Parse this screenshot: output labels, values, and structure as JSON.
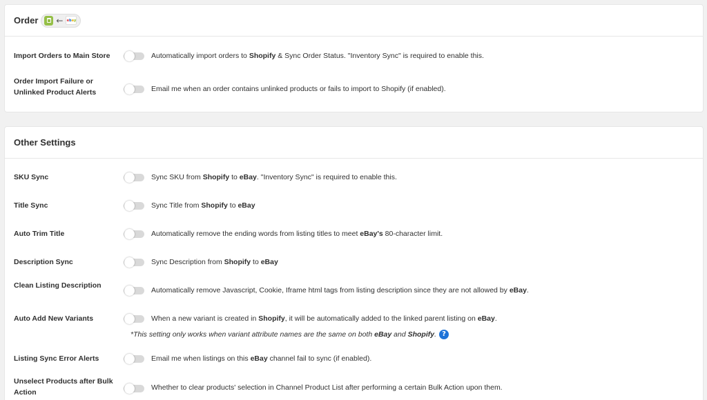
{
  "order_card": {
    "title": "Order",
    "rows": [
      {
        "label": "Import Orders to Main Store",
        "desc": [
          "Automatically import orders to ",
          "Shopify",
          " & Sync Order Status. \"Inventory Sync\" is required to enable this."
        ],
        "enabled": false
      },
      {
        "label": "Order Import Failure or Unlinked Product Alerts",
        "desc": [
          "Email me when an order contains unlinked products or fails to import to Shopify (if enabled)."
        ],
        "enabled": false
      }
    ]
  },
  "other_card": {
    "title": "Other Settings",
    "rows": [
      {
        "label": "SKU Sync",
        "desc": [
          "Sync SKU from ",
          "Shopify",
          " to ",
          "eBay",
          ". \"Inventory Sync\" is required to enable this."
        ],
        "enabled": false
      },
      {
        "label": "Title Sync",
        "desc": [
          "Sync Title from ",
          "Shopify",
          " to ",
          "eBay"
        ],
        "enabled": false
      },
      {
        "label": "Auto Trim Title",
        "desc": [
          "Automatically remove the ending words from listing titles to meet ",
          "eBay's",
          " 80-character limit."
        ],
        "enabled": false
      },
      {
        "label": "Description Sync",
        "desc": [
          "Sync Description from ",
          "Shopify",
          " to ",
          "eBay"
        ],
        "enabled": false
      },
      {
        "label": "Clean Listing Description",
        "desc": [
          "Automatically remove Javascript, Cookie, Iframe html tags from listing description since they are not allowed by ",
          "eBay",
          "."
        ],
        "enabled": false
      },
      {
        "label": "Auto Add New Variants",
        "desc": [
          "When a new variant is created in ",
          "Shopify",
          ", it will be automatically added to the linked parent listing on ",
          "eBay",
          "."
        ],
        "enabled": false,
        "note": [
          "*This setting only works when variant attribute names are the same on both ",
          "eBay",
          " and ",
          "Shopify",
          "."
        ]
      },
      {
        "label": "Listing Sync Error Alerts",
        "desc": [
          "Email me when listings on this ",
          "eBay",
          " channel fail to sync (if enabled)."
        ],
        "enabled": false
      },
      {
        "label": "Unselect Products after Bulk Action",
        "desc": [
          "Whether to clear products' selection in Channel Product List after performing a certain Bulk Action upon them."
        ],
        "enabled": false
      }
    ]
  },
  "icons": {
    "shopify": "shopify-logo-icon",
    "arrow": "arrow-left-icon",
    "ebay": "ebay-logo-icon",
    "help": "help-circle-icon"
  },
  "channel_pill": {
    "ebay_text": [
      "e",
      "b",
      "a",
      "y"
    ]
  },
  "help_glyph": "?",
  "colors": {
    "shopify_green": "#95bf47",
    "help_blue": "#1e73d8",
    "toggle_off": "#d9d9d9"
  }
}
